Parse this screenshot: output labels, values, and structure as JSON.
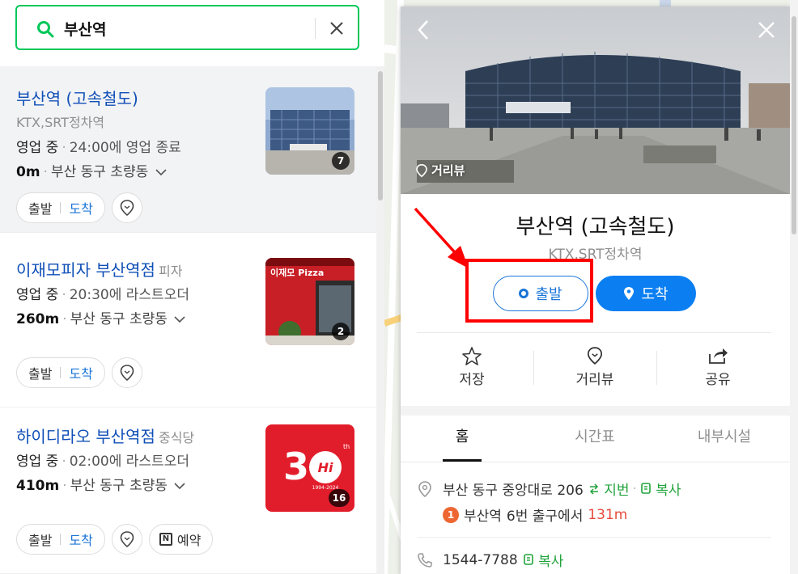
{
  "search": {
    "value": "부산역",
    "placeholder": ""
  },
  "results": [
    {
      "title": "부산역 (고속철도)",
      "category": "",
      "subname": "KTX,SRT정차역",
      "status_state": "영업 중",
      "status_time": "24:00에 영업 종료",
      "distance": "0m",
      "area": "부산 동구 초량동",
      "photo_count": "7",
      "depart": "출발",
      "arrive": "도착",
      "reserve": ""
    },
    {
      "title": "이재모피자 부산역점",
      "category": "피자",
      "subname": "",
      "status_state": "영업 중",
      "status_time": "20:30에 라스트오더",
      "distance": "260m",
      "area": "부산 동구 초량동",
      "photo_count": "2",
      "depart": "출발",
      "arrive": "도착",
      "reserve": "",
      "sign_text": "이재모 Pizza"
    },
    {
      "title": "하이디라오 부산역점",
      "category": "중식당",
      "subname": "",
      "status_state": "영업 중",
      "status_time": "02:00에 라스트오더",
      "distance": "410m",
      "area": "부산 동구 초량동",
      "photo_count": "16",
      "depart": "출발",
      "arrive": "도착",
      "reserve": "예약"
    }
  ],
  "detail": {
    "street_view_label": "거리뷰",
    "title": "부산역 (고속철도)",
    "subtitle": "KTX,SRT정차역",
    "depart_button": "출발",
    "arrive_button": "도착",
    "quick_actions": [
      "저장",
      "거리뷰",
      "공유"
    ],
    "tabs": [
      "홈",
      "시간표",
      "내부시설"
    ],
    "active_tab": "홈",
    "address": "부산 동구 중앙대로 206",
    "jibun_label": "지번",
    "copy_label": "복사",
    "exit_number": "1",
    "exit_station": "부산역",
    "exit_text": "6번 출구에서",
    "exit_distance": "131m",
    "phone": "1544-7788",
    "phone_copy_label": "복사"
  },
  "colors": {
    "search_border": "#03c75a",
    "link_blue": "#0f4fb7",
    "arrive_blue": "#0b7ff2",
    "highlight_red": "#ff0000",
    "green_text": "#21a33c",
    "exit_badge": "#ee6732"
  }
}
